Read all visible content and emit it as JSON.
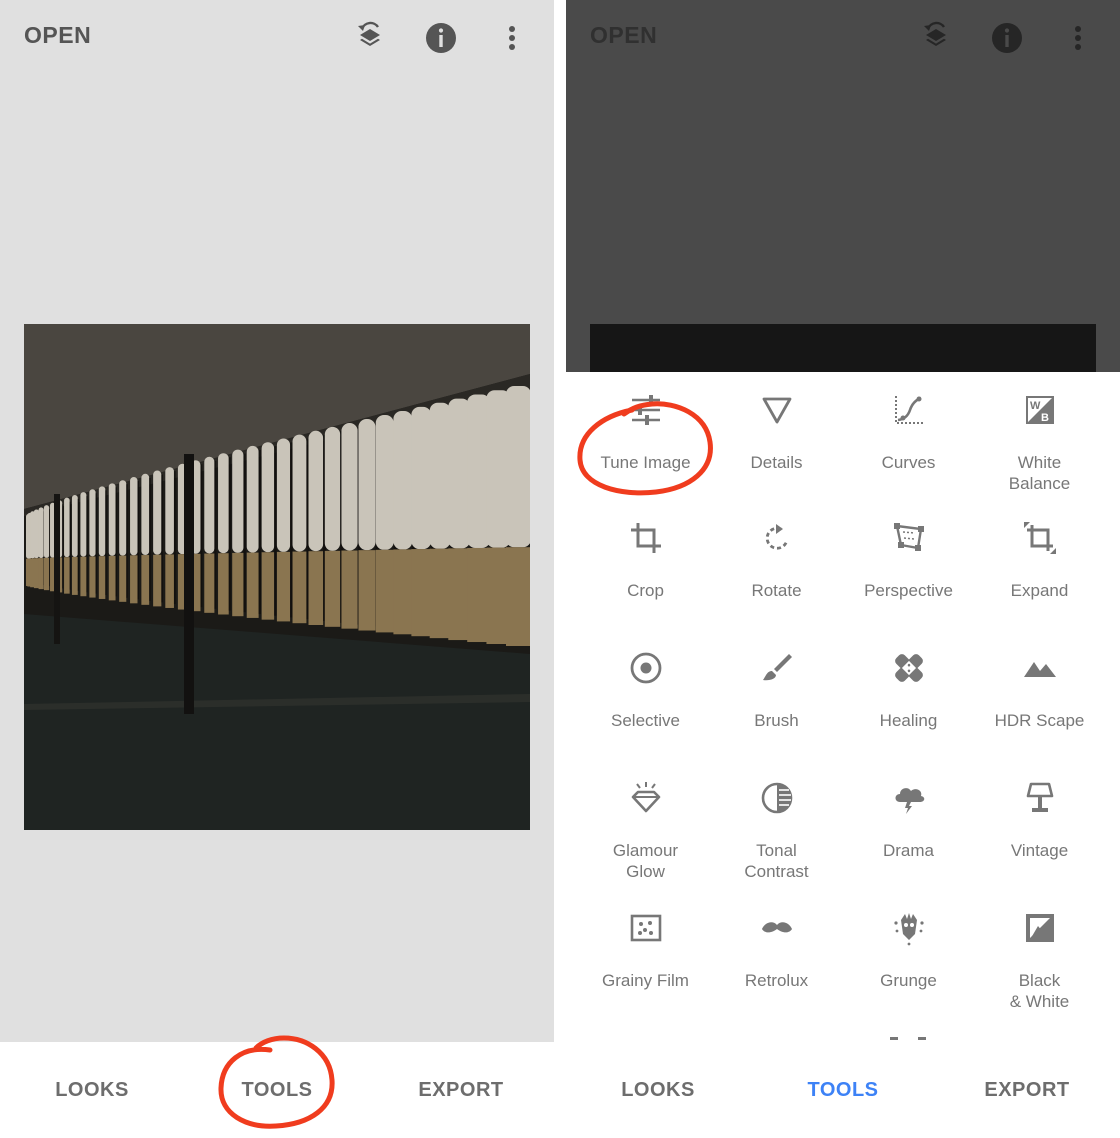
{
  "left": {
    "header": {
      "open_label": "OPEN"
    },
    "icons": [
      "layers-undo-icon",
      "info-icon",
      "more-vert-icon"
    ],
    "bottom_nav": [
      {
        "label": "LOOKS",
        "active": false
      },
      {
        "label": "TOOLS",
        "active": false
      },
      {
        "label": "EXPORT",
        "active": false
      }
    ]
  },
  "right": {
    "header": {
      "open_label": "OPEN"
    },
    "icons": [
      "layers-undo-icon",
      "info-icon",
      "more-vert-icon"
    ],
    "tools": [
      {
        "label": "Tune Image",
        "icon": "tune-icon"
      },
      {
        "label": "Details",
        "icon": "details-triangle-icon"
      },
      {
        "label": "Curves",
        "icon": "curves-icon"
      },
      {
        "label": "White\nBalance",
        "icon": "white-balance-icon"
      },
      {
        "label": "Crop",
        "icon": "crop-icon"
      },
      {
        "label": "Rotate",
        "icon": "rotate-icon"
      },
      {
        "label": "Perspective",
        "icon": "perspective-icon"
      },
      {
        "label": "Expand",
        "icon": "expand-icon"
      },
      {
        "label": "Selective",
        "icon": "selective-icon"
      },
      {
        "label": "Brush",
        "icon": "brush-icon"
      },
      {
        "label": "Healing",
        "icon": "healing-icon"
      },
      {
        "label": "HDR Scape",
        "icon": "hdr-scape-icon"
      },
      {
        "label": "Glamour\nGlow",
        "icon": "glamour-glow-icon"
      },
      {
        "label": "Tonal\nContrast",
        "icon": "tonal-contrast-icon"
      },
      {
        "label": "Drama",
        "icon": "drama-icon"
      },
      {
        "label": "Vintage",
        "icon": "vintage-icon"
      },
      {
        "label": "Grainy Film",
        "icon": "grainy-film-icon"
      },
      {
        "label": "Retrolux",
        "icon": "retrolux-icon"
      },
      {
        "label": "Grunge",
        "icon": "grunge-icon"
      },
      {
        "label": "Black\n& White",
        "icon": "black-white-icon"
      }
    ],
    "bottom_nav": [
      {
        "label": "LOOKS",
        "active": false
      },
      {
        "label": "TOOLS",
        "active": true
      },
      {
        "label": "EXPORT",
        "active": false
      }
    ]
  },
  "colors": {
    "accent": "#3d82f6",
    "annotation": "#f03c1e",
    "text_gray": "#777777"
  }
}
